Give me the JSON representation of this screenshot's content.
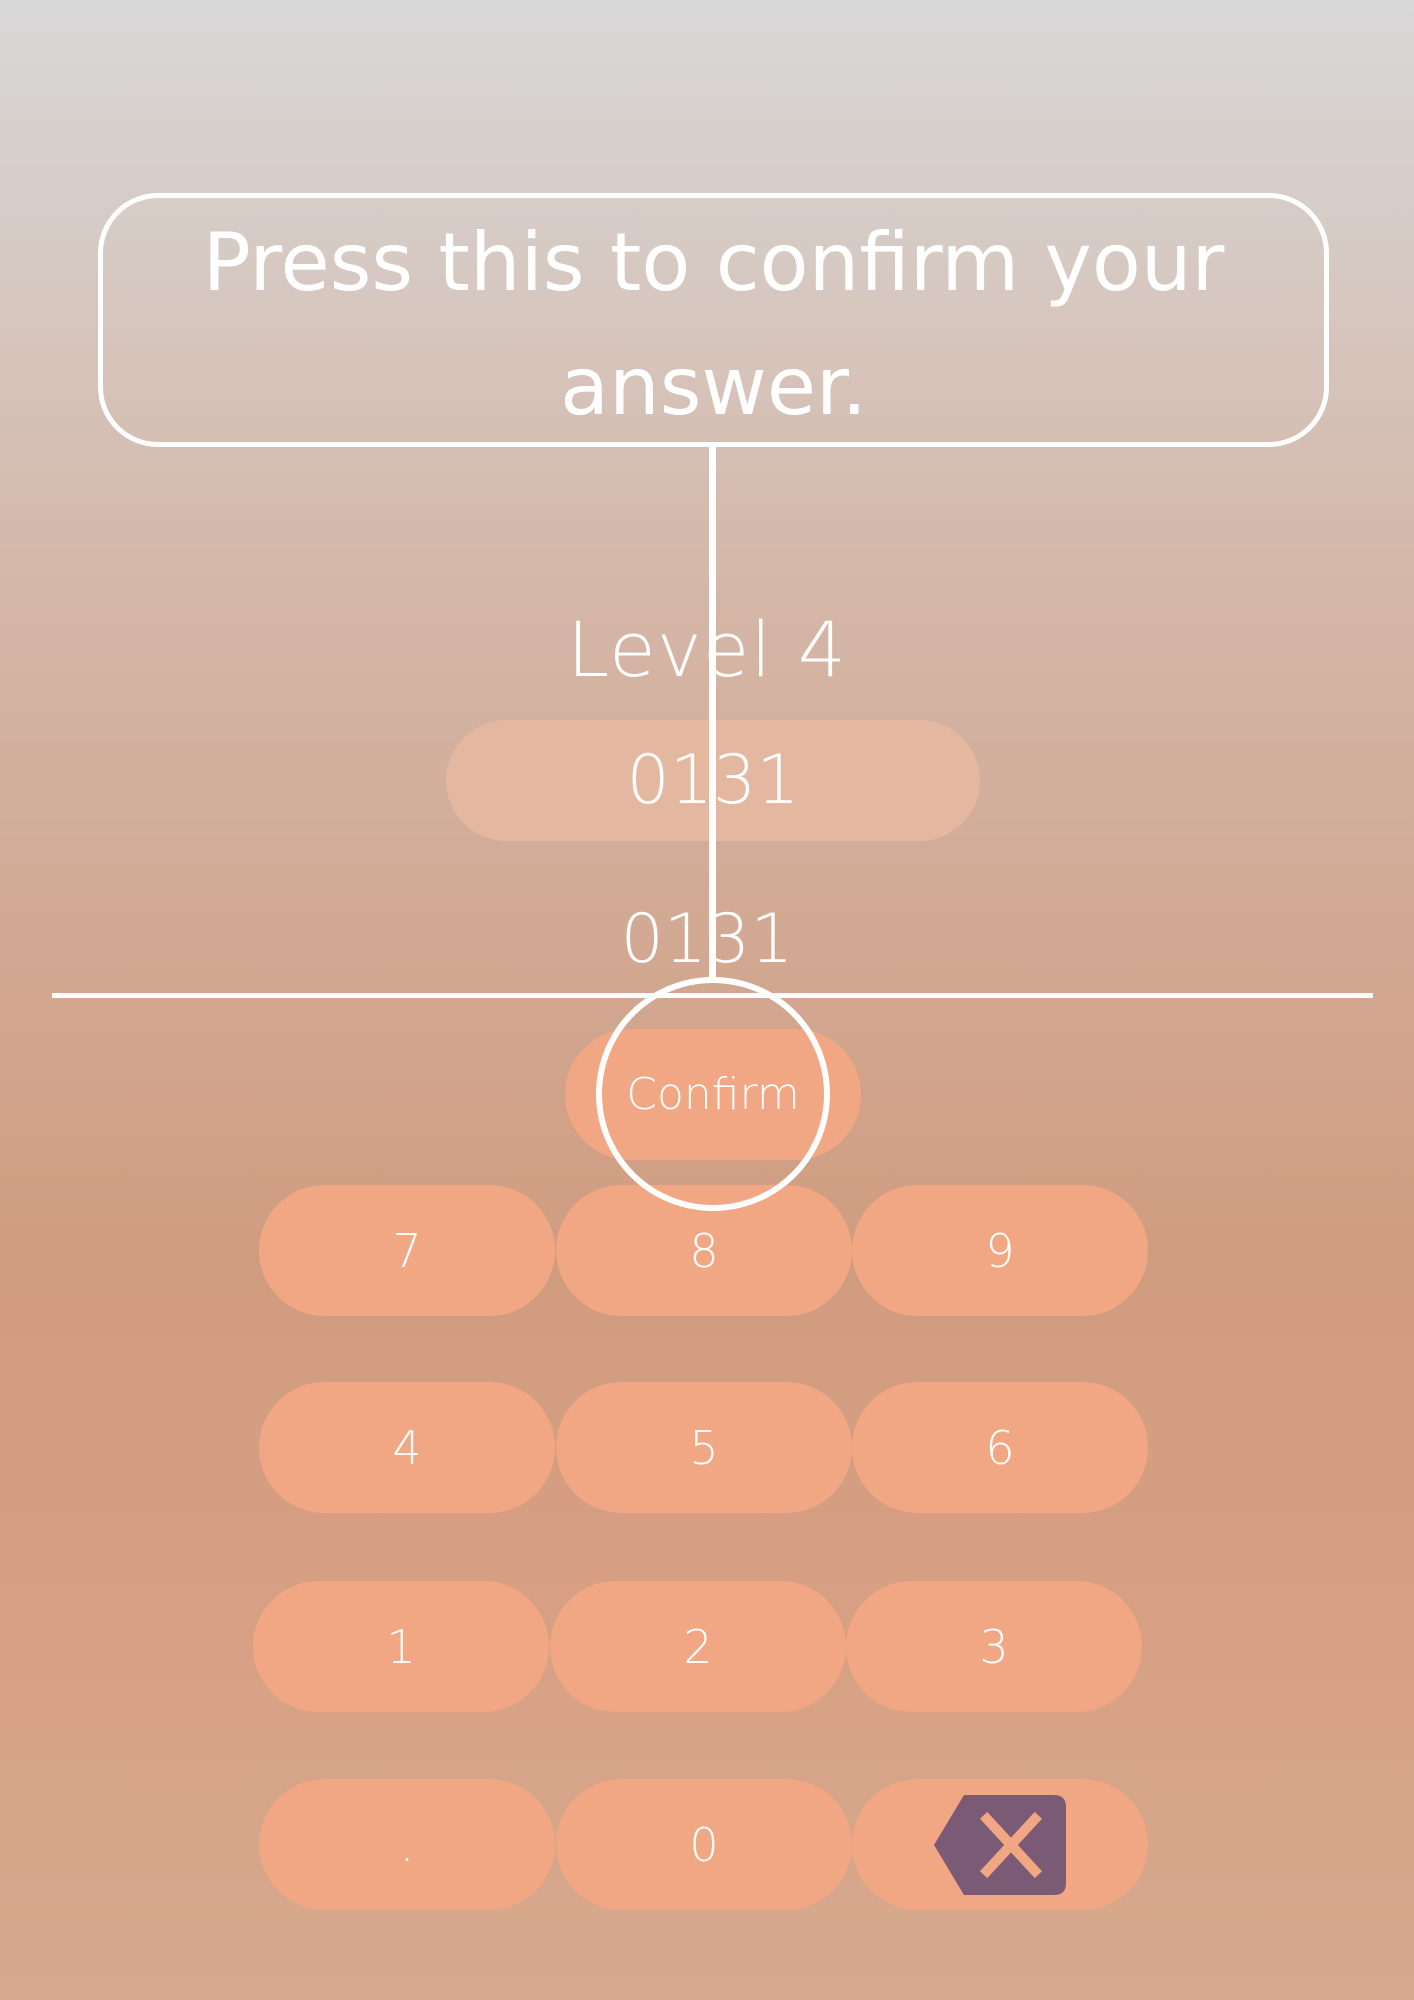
{
  "tutorial": {
    "callout_text": "Press this to confirm your answer."
  },
  "game": {
    "level_label": "Level 4",
    "target_number": "0131",
    "answer_value": "0131",
    "confirm_label": "Confirm"
  },
  "keypad": {
    "keys": [
      "7",
      "8",
      "9",
      "4",
      "5",
      "6",
      "1",
      "2",
      "3",
      ".",
      "0"
    ],
    "backspace_icon": "backspace-icon"
  },
  "colors": {
    "key_fill": "#f1a783",
    "target_fill": "#e4b8a0",
    "backspace_fill": "#7a5a75",
    "text": "#ffffff"
  }
}
